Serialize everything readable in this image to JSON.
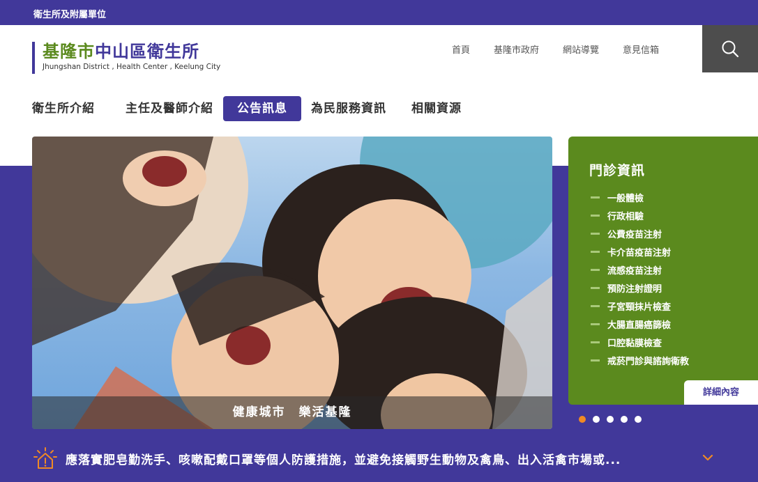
{
  "topbar": {
    "link": "衛生所及附屬單位"
  },
  "logo": {
    "title_part1": "基隆市",
    "title_part2": "中山區衛生所",
    "subtitle": "Jhungshan District , Health Center , Keelung City"
  },
  "util_nav": [
    "首頁",
    "基隆市政府",
    "網站導覽",
    "意見信箱"
  ],
  "search": {
    "icon": "search-icon"
  },
  "main_nav": [
    {
      "label": "衛生所介紹",
      "active": false
    },
    {
      "label": "主任及醫師介紹",
      "active": false
    },
    {
      "label": "公告訊息",
      "active": true
    },
    {
      "label": "為民服務資訊",
      "active": false
    },
    {
      "label": "相關資源",
      "active": false
    }
  ],
  "hero": {
    "caption": "健康城市　樂活基隆"
  },
  "clinic": {
    "title": "門診資訊",
    "items": [
      "一般體檢",
      "行政相驗",
      "公費疫苗注射",
      "卡介苗疫苗注射",
      "流感疫苗注射",
      "預防注射證明",
      "子宮頸抹片檢查",
      "大腸直腸癌篩檢",
      "口腔黏膜檢查",
      "戒菸門診與諮詢衛教"
    ],
    "detail_label": "詳細內容"
  },
  "carousel": {
    "count": 5,
    "active_index": 0
  },
  "notice": {
    "text": "應落實肥皂勤洗手、咳嗽配戴口罩等個人防護措施，並避免接觸野生動物及禽鳥、出入活禽市場或..."
  },
  "colors": {
    "brand_purple": "#41389a",
    "brand_green": "#5b8a1e",
    "accent_orange": "#f08a24"
  }
}
